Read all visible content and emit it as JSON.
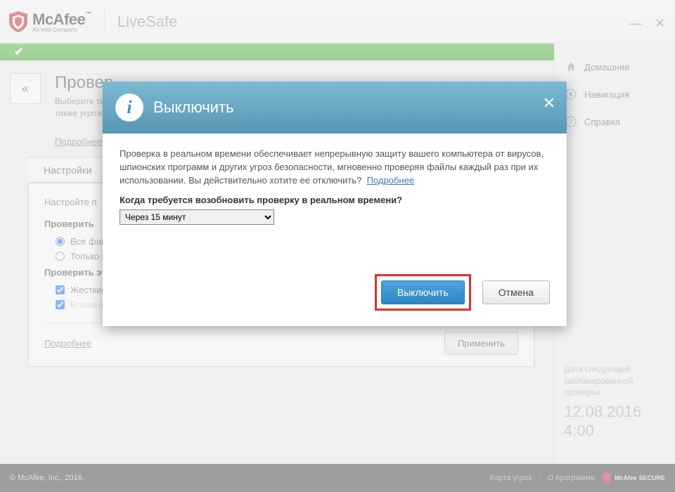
{
  "brand": {
    "name": "McAfee",
    "tm": "™",
    "tagline": "An Intel Company",
    "product": "LiveSafe"
  },
  "sidebar": {
    "items": [
      {
        "label": "Домашняя"
      },
      {
        "label": "Навигация"
      },
      {
        "label": "Справка"
      }
    ],
    "next_scan_label": "Дата следующей запланированной проверки:",
    "next_scan_date": "12.08.2016",
    "next_scan_time": "4:00"
  },
  "page": {
    "title": "Провер",
    "desc_line1": "Выберите ти",
    "desc_line2": "также угрозы",
    "more": "Подробнее"
  },
  "settings": {
    "tab": "Настройки",
    "intro": "Настройте п",
    "section1": "Проверить",
    "opt_all": "Все файлы (рекомендуется)",
    "opt_programs": "Только программы и документы",
    "section2": "Проверить эти вложения и расположения",
    "chk_hdd": "Жесткие диски ПК (автоматически)",
    "chk_email": "Вложения электронной почты",
    "more": "Подробнее",
    "apply": "Применить"
  },
  "modal": {
    "title": "Выключить",
    "body": "Проверка в реальном времени обеспечивает непрерывную защиту вашего компьютера от вирусов, шпионских программ и других угроз безопасности, мгновенно проверяя файлы каждый раз при их использовании. Вы действительно хотите ее отключить?",
    "more": "Подробнее",
    "question": "Когда требуется возобновить проверку в реальном времени?",
    "select_value": "Через 15 минут",
    "confirm": "Выключить",
    "cancel": "Отмена"
  },
  "footer": {
    "copyright": "© McAfee, Inc., 2016.",
    "link_map": "Карта угроз",
    "link_about": "О программе",
    "secure": "McAfee SECURE"
  }
}
